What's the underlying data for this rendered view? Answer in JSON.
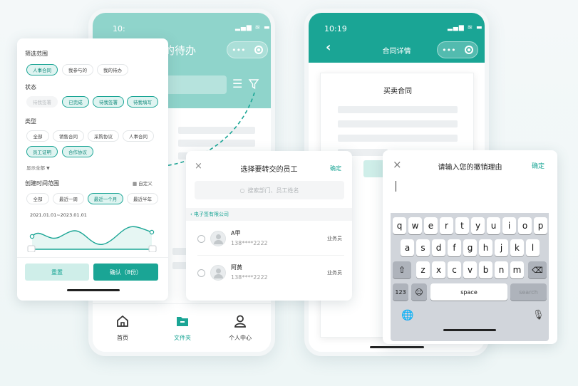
{
  "phone1": {
    "time": "10:",
    "title_fragment": "的待办",
    "nav": [
      {
        "label": "首页"
      },
      {
        "label": "文件夹"
      },
      {
        "label": "个人中心"
      }
    ]
  },
  "phone2": {
    "time": "10:19",
    "header_title": "合同详情",
    "doc_title": "买卖合同"
  },
  "filter": {
    "scope_title": "筛选范围",
    "scope_options": [
      "人事合同",
      "我参与的",
      "我的待办"
    ],
    "status_title": "状态",
    "status_options": [
      "待我签署",
      "已完成",
      "待我签署",
      "待我填写"
    ],
    "type_title": "类型",
    "type_options": [
      "全部",
      "销售合同",
      "采购协议",
      "人事合同",
      "员工证明",
      "合作协议"
    ],
    "show_all": "显示全部",
    "time_title": "创建时间范围",
    "custom_label": "自定义",
    "time_options": [
      "全部",
      "最近一周",
      "最近一个月",
      "最近半年"
    ],
    "date_range": "2021.01.01~2023.01.01",
    "reset_label": "重置",
    "confirm_label": "确认（8份）"
  },
  "employee_dialog": {
    "title": "选择要转交的员工",
    "confirm": "确定",
    "search_placeholder": "搜索部门、员工姓名",
    "company": "电子签有限公司",
    "employees": [
      {
        "name": "A甲",
        "phone": "138****2222",
        "role": "业务员"
      },
      {
        "name": "阿黄",
        "phone": "138****2222",
        "role": "业务员"
      }
    ]
  },
  "reason_dialog": {
    "title": "请输入您的撤销理由",
    "confirm": "确定",
    "keyboard": {
      "row1": [
        "q",
        "w",
        "e",
        "r",
        "t",
        "y",
        "u",
        "i",
        "o",
        "p"
      ],
      "row2": [
        "a",
        "s",
        "d",
        "f",
        "g",
        "h",
        "j",
        "k",
        "l"
      ],
      "row3": [
        "z",
        "x",
        "c",
        "v",
        "b",
        "n",
        "m"
      ],
      "num_key": "123",
      "space_key": "space",
      "search_key": "search"
    }
  },
  "colors": {
    "accent": "#1aa595",
    "accent_light": "#dff4f1",
    "background": "#f1f7f7"
  },
  "icons": [
    "filter-icon",
    "home-icon",
    "folder-icon",
    "person-icon",
    "back-icon",
    "close-icon",
    "search-icon",
    "calendar-icon",
    "shift-icon",
    "backspace-icon",
    "emoji-icon",
    "globe-icon",
    "mic-icon"
  ]
}
